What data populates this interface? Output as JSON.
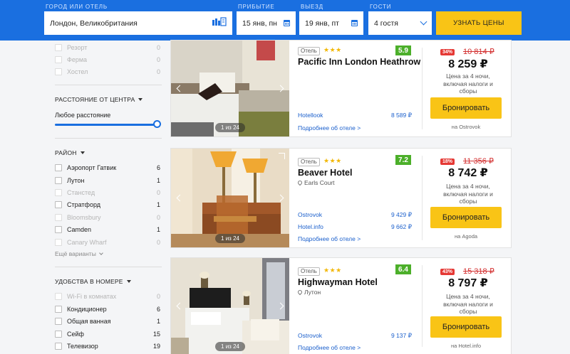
{
  "search": {
    "destination_label": "ГОРОД ИЛИ ОТЕЛЬ",
    "destination_value": "Лондон, Великобритания",
    "checkin_label": "ПРИБЫТИЕ",
    "checkin_value": "15 янв, пн",
    "checkout_label": "ВЫЕЗД",
    "checkout_value": "19 янв, пт",
    "guests_label": "ГОСТИ",
    "guests_value": "4 гостя",
    "button_label": "УЗНАТЬ ЦЕНЫ",
    "map_icon": "map-icon",
    "calendar_icon": "calendar-icon"
  },
  "sidebar": {
    "property_types": [
      {
        "name": "Резорт",
        "count": "0",
        "dim": true
      },
      {
        "name": "Ферма",
        "count": "0",
        "dim": true
      },
      {
        "name": "Хостел",
        "count": "0",
        "dim": true
      }
    ],
    "distance": {
      "heading": "РАССТОЯНИЕ ОТ ЦЕНТРА",
      "value": "Любое расстояние",
      "level": 1.0
    },
    "district": {
      "heading": "РАЙОН",
      "items": [
        {
          "name": "Аэропорт Гатвик",
          "count": "6",
          "dim": false
        },
        {
          "name": "Лутон",
          "count": "1",
          "dim": false
        },
        {
          "name": "Станстед",
          "count": "0",
          "dim": true
        },
        {
          "name": "Стратфорд",
          "count": "1",
          "dim": false
        },
        {
          "name": "Bloomsbury",
          "count": "0",
          "dim": true
        },
        {
          "name": "Camden",
          "count": "1",
          "dim": false
        },
        {
          "name": "Canary Wharf",
          "count": "0",
          "dim": true
        }
      ],
      "more": "Ещё варианты"
    },
    "amenities": {
      "heading": "УДОБСТВА В НОМЕРЕ",
      "items": [
        {
          "name": "Wi-Fi в комнатах",
          "count": "0",
          "dim": true
        },
        {
          "name": "Кондиционер",
          "count": "6",
          "dim": false
        },
        {
          "name": "Общая ванная",
          "count": "1",
          "dim": false
        },
        {
          "name": "Сейф",
          "count": "15",
          "dim": false
        },
        {
          "name": "Телевизор",
          "count": "19",
          "dim": false
        }
      ]
    }
  },
  "hotels": [
    {
      "type": "Отель",
      "stars": "★★★",
      "score": "5.9",
      "name": "Pacific Inn London Heathrow",
      "location": "",
      "providers": [
        {
          "name": "Hotellook",
          "price": "8 589 ₽"
        }
      ],
      "details": "Подробнее об отеле >",
      "discount": "34%",
      "old_price": "10 814 ₽",
      "price": "8 259 ₽",
      "note": "Цена за 4 ночи, включая налоги и сборы",
      "button": "Бронировать",
      "source": "на Ostrovok",
      "photo_counter": "1 из 24"
    },
    {
      "type": "Отель",
      "stars": "★★★",
      "score": "7.2",
      "name": "Beaver Hotel",
      "location": "Earls Court",
      "providers": [
        {
          "name": "Ostrovok",
          "price": "9 429 ₽"
        },
        {
          "name": "Hotel.info",
          "price": "9 662 ₽"
        }
      ],
      "details": "Подробнее об отеле >",
      "discount": "18%",
      "old_price": "11 356 ₽",
      "price": "8 742 ₽",
      "note": "Цена за 4 ночи, включая налоги и сборы",
      "button": "Бронировать",
      "source": "на Agoda",
      "photo_counter": "1 из 24"
    },
    {
      "type": "Отель",
      "stars": "★★★",
      "score": "6.4",
      "name": "Highwayman Hotel",
      "location": "Лутон",
      "providers": [
        {
          "name": "Ostrovok",
          "price": "9 137 ₽"
        }
      ],
      "details": "Подробнее об отеле >",
      "discount": "43%",
      "old_price": "15 318 ₽",
      "price": "8 797 ₽",
      "note": "Цена за 4 ночи, включая налоги и сборы",
      "button": "Бронировать",
      "source": "на Hotel.info",
      "photo_counter": "1 из 24"
    }
  ]
}
